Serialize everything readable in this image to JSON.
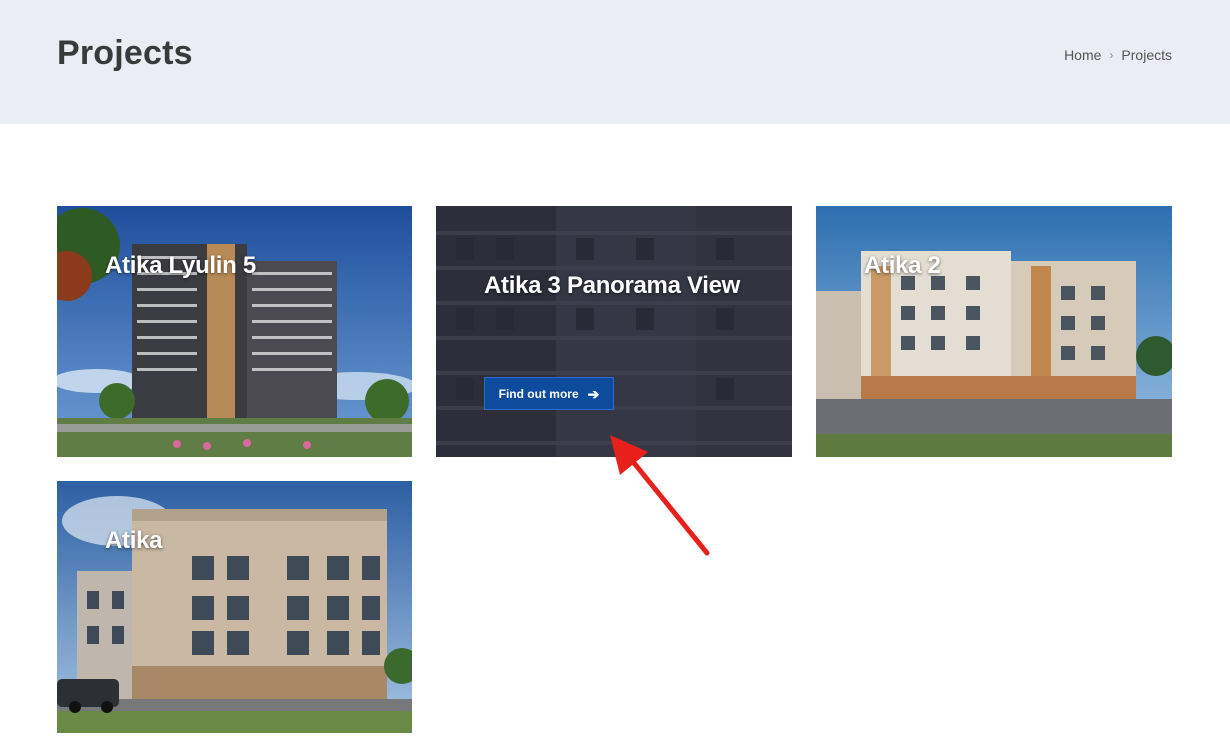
{
  "header": {
    "title": "Projects",
    "breadcrumb": {
      "home": "Home",
      "separator": "›",
      "current": "Projects"
    }
  },
  "projects": [
    {
      "title": "Atika Lyulin 5"
    },
    {
      "title": "Atika 3 Panorama View",
      "button_label": "Find out more",
      "button_icon": "arrow-right-icon"
    },
    {
      "title": "Atika 2"
    },
    {
      "title": "Atika"
    }
  ],
  "colors": {
    "header_bg": "#ebedf5",
    "button_bg": "#0d4c9c",
    "annotation_arrow": "#e8201c"
  }
}
